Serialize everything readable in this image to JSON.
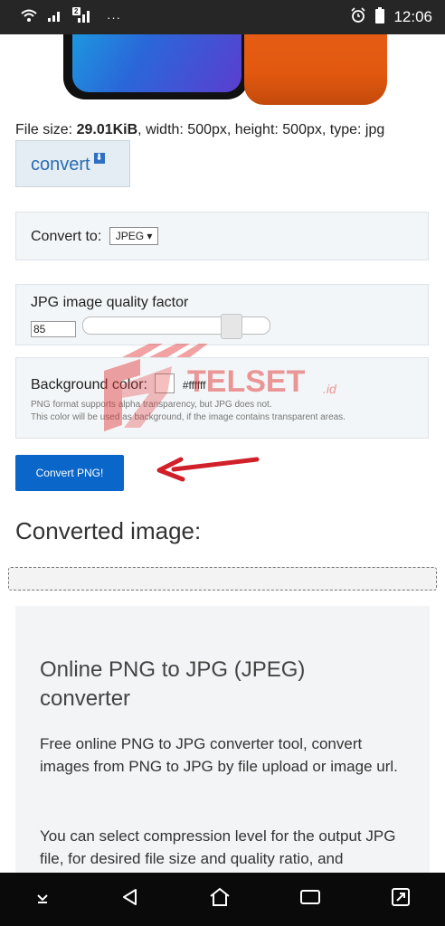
{
  "status_bar": {
    "time": "12:06",
    "sim_label": "2",
    "more": "···"
  },
  "file_info": {
    "prefix": "File size: ",
    "size": "29.01KiB",
    "rest": ", width: 500px, height: 500px, type: jpg"
  },
  "convert_top": {
    "label": "convert"
  },
  "convert_to": {
    "label": "Convert to:",
    "selected": "JPEG ▾"
  },
  "quality": {
    "label": "JPG image quality factor",
    "value": "85",
    "slider_level": 0.85
  },
  "background": {
    "label": "Background color:",
    "hex": "#ffffff",
    "note1": "PNG format supports alpha transparency, but JPG does not.",
    "note2": "This color will be used as background, if the image contains transparent areas."
  },
  "convert_button": {
    "label": "Convert PNG!"
  },
  "converted_title": "Converted image:",
  "info": {
    "title": "Online PNG to JPG (JPEG) converter",
    "p1": "Free online PNG to JPG converter tool, convert images from PNG to JPG by file upload or image url.",
    "p2": "You can select compression level for the output JPG file, for desired file size and quality ratio, and"
  },
  "watermark": {
    "text": "TELSET",
    "suffix": ".id"
  },
  "colors": {
    "accent": "#0a66c8",
    "arrow": "#d0202a",
    "photo_orange": "#e2580f",
    "screen_blue": "#2a67d9"
  }
}
